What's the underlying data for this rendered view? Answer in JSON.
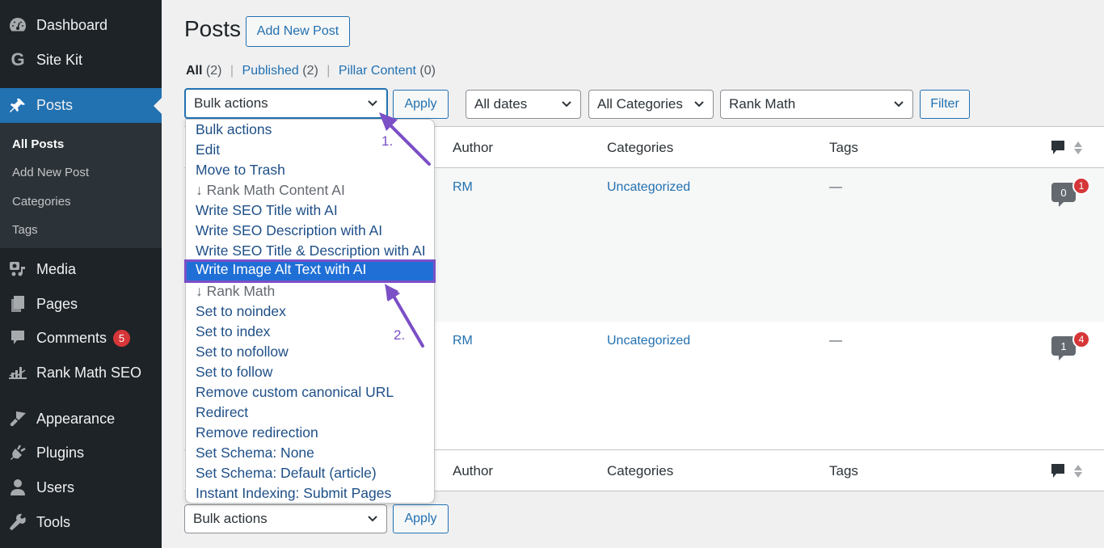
{
  "sidebar": {
    "items": [
      {
        "label": "Dashboard",
        "icon": "dashboard-icon"
      },
      {
        "label": "Site Kit",
        "icon": "google-g-icon"
      },
      {
        "label": "Posts",
        "icon": "pin-icon",
        "active": true
      },
      {
        "label": "Media",
        "icon": "media-icon"
      },
      {
        "label": "Pages",
        "icon": "pages-icon"
      },
      {
        "label": "Comments",
        "icon": "comment-icon",
        "badge": "5"
      },
      {
        "label": "Rank Math SEO",
        "icon": "rank-math-icon"
      },
      {
        "label": "Appearance",
        "icon": "paintbrush-icon"
      },
      {
        "label": "Plugins",
        "icon": "plug-icon"
      },
      {
        "label": "Users",
        "icon": "user-icon"
      },
      {
        "label": "Tools",
        "icon": "wrench-icon"
      }
    ],
    "submenu": [
      {
        "label": "All Posts",
        "current": true
      },
      {
        "label": "Add New Post"
      },
      {
        "label": "Categories"
      },
      {
        "label": "Tags"
      }
    ]
  },
  "header": {
    "title": "Posts",
    "add_new_label": "Add New Post"
  },
  "views": [
    {
      "label": "All",
      "count": "(2)",
      "current": true
    },
    {
      "label": "Published",
      "count": "(2)"
    },
    {
      "label": "Pillar Content",
      "count": "(0)"
    }
  ],
  "toolbar": {
    "bulk_actions_value": "Bulk actions",
    "apply_label": "Apply",
    "dates_value": "All dates",
    "categories_value": "All Categories",
    "rank_math_value": "Rank Math",
    "filter_label": "Filter"
  },
  "table": {
    "columns": {
      "author": "Author",
      "categories": "Categories",
      "tags": "Tags"
    },
    "rows": [
      {
        "author": "RM",
        "category": "Uncategorized",
        "tags": "—",
        "comments": "0",
        "pending": "1"
      },
      {
        "author": "RM",
        "category": "Uncategorized",
        "tags": "—",
        "comments": "1",
        "pending": "4"
      }
    ]
  },
  "bulk_dropdown": {
    "options": [
      {
        "label": "Bulk actions"
      },
      {
        "label": "Edit"
      },
      {
        "label": "Move to Trash"
      },
      {
        "label": "↓ Rank Math Content AI",
        "group": true
      },
      {
        "label": "Write SEO Title with AI"
      },
      {
        "label": "Write SEO Description with AI"
      },
      {
        "label": "Write SEO Title & Description with AI"
      },
      {
        "label": "Write Image Alt Text with AI",
        "highlighted": true
      },
      {
        "label": "↓ Rank Math",
        "group": true
      },
      {
        "label": "Set to noindex"
      },
      {
        "label": "Set to index"
      },
      {
        "label": "Set to nofollow"
      },
      {
        "label": "Set to follow"
      },
      {
        "label": "Remove custom canonical URL"
      },
      {
        "label": "Redirect"
      },
      {
        "label": "Remove redirection"
      },
      {
        "label": "Set Schema: None"
      },
      {
        "label": "Set Schema: Default (article)"
      },
      {
        "label": "Instant Indexing: Submit Pages"
      }
    ]
  },
  "bottom_toolbar": {
    "bulk_actions_value": "Bulk actions",
    "apply_label": "Apply"
  },
  "annotations": {
    "step1": "1.",
    "step2": "2.",
    "color": "#7b4fc6"
  }
}
